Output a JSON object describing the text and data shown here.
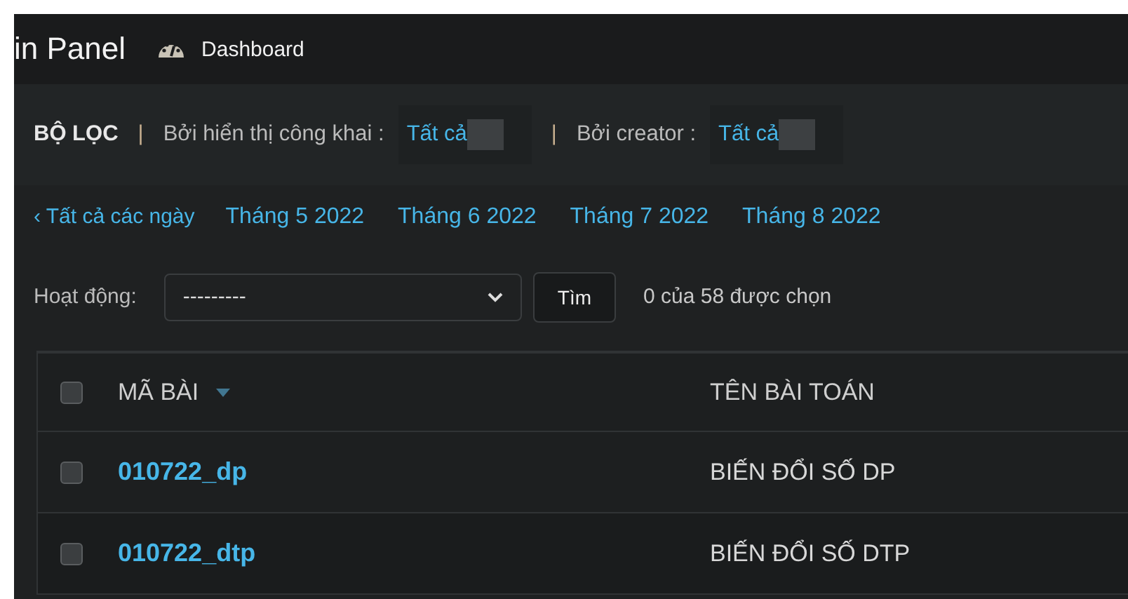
{
  "header": {
    "title": "in Panel",
    "nav_link": "Dashboard"
  },
  "filter_bar": {
    "heading": "BỘ LỌC",
    "separator": "|",
    "filters": [
      {
        "label": "Bởi hiển thị công khai :",
        "value": "Tất cả"
      },
      {
        "label": "Bởi creator :",
        "value": "Tất cả"
      }
    ]
  },
  "date_nav": {
    "back": "‹ Tất cả các ngày",
    "months": [
      "Tháng 5 2022",
      "Tháng 6 2022",
      "Tháng 7 2022",
      "Tháng 8 2022"
    ]
  },
  "actions": {
    "label": "Hoạt động:",
    "select_value": "---------",
    "button": "Tìm",
    "counter": "0 của 58 được chọn"
  },
  "table": {
    "select_all_checked": false,
    "columns": [
      {
        "label": "MÃ BÀI",
        "sorted": true
      },
      {
        "label": "TÊN BÀI TOÁN",
        "sorted": false
      }
    ],
    "rows": [
      {
        "checked": false,
        "code": "010722_dp",
        "name": "BIẾN ĐỔI SỐ DP"
      },
      {
        "checked": false,
        "code": "010722_dtp",
        "name": "BIẾN ĐỔI SỐ DTP"
      }
    ]
  }
}
